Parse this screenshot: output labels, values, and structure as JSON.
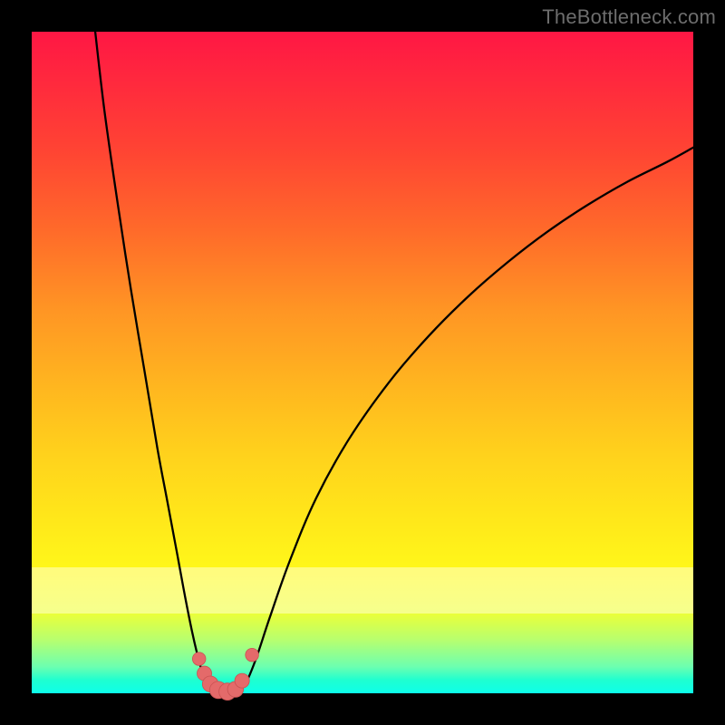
{
  "watermark": "TheBottleneck.com",
  "colors": {
    "black": "#000000",
    "curve": "#000000",
    "marker_fill": "#e46a6a",
    "marker_stroke": "#c95252"
  },
  "chart_data": {
    "type": "line",
    "title": "",
    "xlabel": "",
    "ylabel": "",
    "xlim": [
      0,
      100
    ],
    "ylim": [
      0,
      100
    ],
    "note": "No numeric axis ticks or labels visible; values are percentage coordinates estimated from pixel positions within the 730×730 plot area (origin bottom-left).",
    "series": [
      {
        "name": "left-branch",
        "x": [
          9.6,
          11,
          13,
          15,
          17,
          19,
          20.5,
          22,
          23.2,
          24.2,
          25,
          25.6,
          26.2,
          27,
          27.5
        ],
        "y": [
          100,
          88,
          74,
          61,
          49,
          37,
          29,
          21,
          14.5,
          9.5,
          6,
          3.8,
          2.2,
          0.6,
          0.3
        ]
      },
      {
        "name": "valley-floor",
        "x": [
          27.5,
          28.5,
          29.5,
          30.5,
          31.5
        ],
        "y": [
          0.3,
          0.1,
          0.1,
          0.15,
          0.4
        ]
      },
      {
        "name": "right-branch",
        "x": [
          31.5,
          32.5,
          34,
          36,
          39,
          43,
          48,
          54,
          60,
          66,
          72,
          78,
          84,
          90,
          96,
          100
        ],
        "y": [
          0.4,
          1.8,
          5.5,
          11.5,
          20,
          29.5,
          38.5,
          47,
          54,
          60,
          65.2,
          69.8,
          73.8,
          77.3,
          80.3,
          82.5
        ]
      }
    ],
    "markers": {
      "name": "valley-markers",
      "points": [
        {
          "x": 25.3,
          "y": 5.2,
          "r": 1.0
        },
        {
          "x": 26.1,
          "y": 3.0,
          "r": 1.1
        },
        {
          "x": 27.0,
          "y": 1.4,
          "r": 1.2
        },
        {
          "x": 28.2,
          "y": 0.5,
          "r": 1.3
        },
        {
          "x": 29.6,
          "y": 0.25,
          "r": 1.3
        },
        {
          "x": 30.8,
          "y": 0.6,
          "r": 1.2
        },
        {
          "x": 31.8,
          "y": 1.9,
          "r": 1.1
        },
        {
          "x": 33.3,
          "y": 5.8,
          "r": 1.0
        }
      ]
    }
  }
}
